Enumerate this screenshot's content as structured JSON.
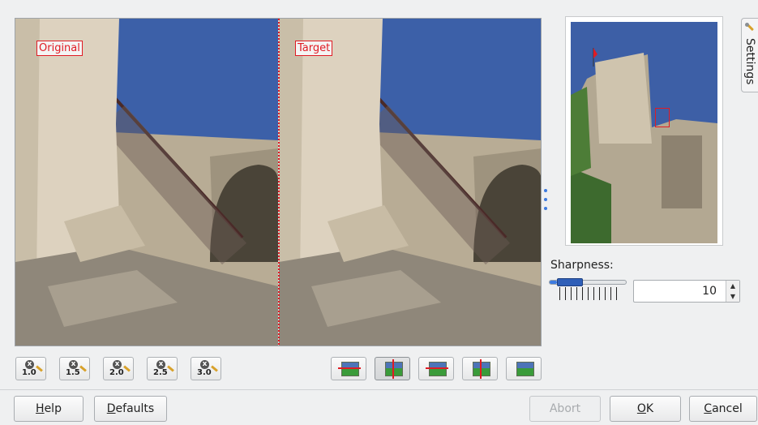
{
  "preview": {
    "original_label": "Original",
    "target_label": "Target"
  },
  "settings_tab": {
    "label": "Settings",
    "icon": "wrench-icon"
  },
  "sharpness": {
    "label": "Sharpness:",
    "value": "10",
    "slider_fraction": 0.1
  },
  "zoom_buttons": [
    {
      "label": "1.0",
      "icon": "zoom-icon"
    },
    {
      "label": "1.5",
      "icon": "zoom-icon"
    },
    {
      "label": "2.0",
      "icon": "zoom-icon"
    },
    {
      "label": "2.5",
      "icon": "zoom-icon"
    },
    {
      "label": "3.0",
      "icon": "zoom-icon"
    }
  ],
  "mode_buttons": [
    {
      "name": "split-vertical-duplicate",
      "active": false
    },
    {
      "name": "split-vertical-card",
      "active": true
    },
    {
      "name": "split-horizontal",
      "active": false
    },
    {
      "name": "split-vertical",
      "active": false
    },
    {
      "name": "target-only",
      "active": false
    }
  ],
  "buttons": {
    "help": {
      "mnemonic": "H",
      "rest": "elp"
    },
    "defaults": {
      "mnemonic": "D",
      "rest": "efaults"
    },
    "abort": {
      "text": "Abort"
    },
    "ok": {
      "mnemonic": "O",
      "rest": "K"
    },
    "cancel": {
      "mnemonic": "C",
      "rest": "ancel"
    }
  },
  "colors": {
    "accent": "#3d7be0",
    "marker": "#e01b24"
  }
}
